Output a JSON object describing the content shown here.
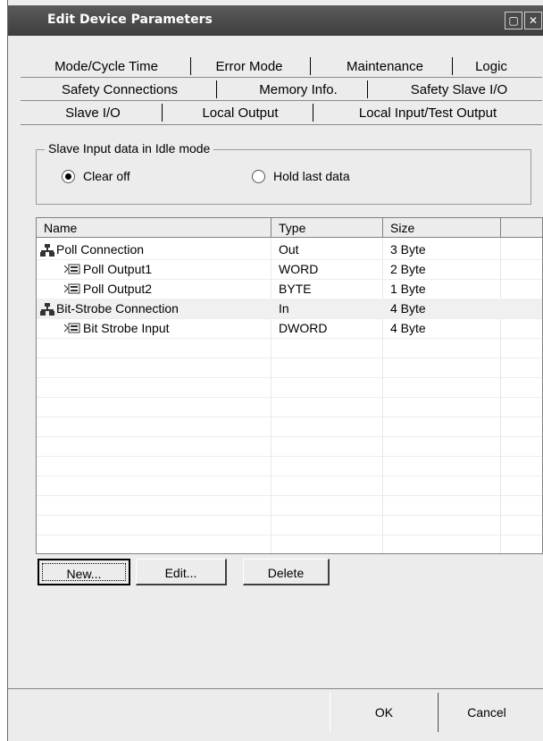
{
  "window": {
    "title": "Edit Device Parameters"
  },
  "tabs": {
    "row1": [
      "Mode/Cycle Time",
      "Error Mode",
      "Maintenance",
      "Logic"
    ],
    "row2": [
      "Safety Connections",
      "Memory Info.",
      "Safety Slave I/O"
    ],
    "row3": [
      "Slave I/O",
      "Local Output",
      "Local Input/Test Output"
    ]
  },
  "idle_group": {
    "legend": "Slave Input data in Idle mode",
    "options": [
      "Clear off",
      "Hold last data"
    ],
    "selected": "Clear off"
  },
  "table": {
    "columns": [
      "Name",
      "Type",
      "Size"
    ],
    "rows": [
      {
        "name": "Poll Connection",
        "type": "Out",
        "size": "3 Byte",
        "icon": "connection-icon"
      },
      {
        "name": "Poll Output1",
        "type": "WORD",
        "size": "2 Byte",
        "icon": "io-tag-icon"
      },
      {
        "name": "Poll Output2",
        "type": "BYTE",
        "size": "1 Byte",
        "icon": "io-tag-icon"
      },
      {
        "name": "Bit-Strobe Connection",
        "type": "In",
        "size": "4 Byte",
        "icon": "connection-icon"
      },
      {
        "name": "Bit Strobe Input",
        "type": "DWORD",
        "size": "4 Byte",
        "icon": "io-tag-icon"
      }
    ]
  },
  "buttons": {
    "new": "New...",
    "edit": "Edit...",
    "delete": "Delete",
    "ok": "OK",
    "cancel": "Cancel"
  }
}
